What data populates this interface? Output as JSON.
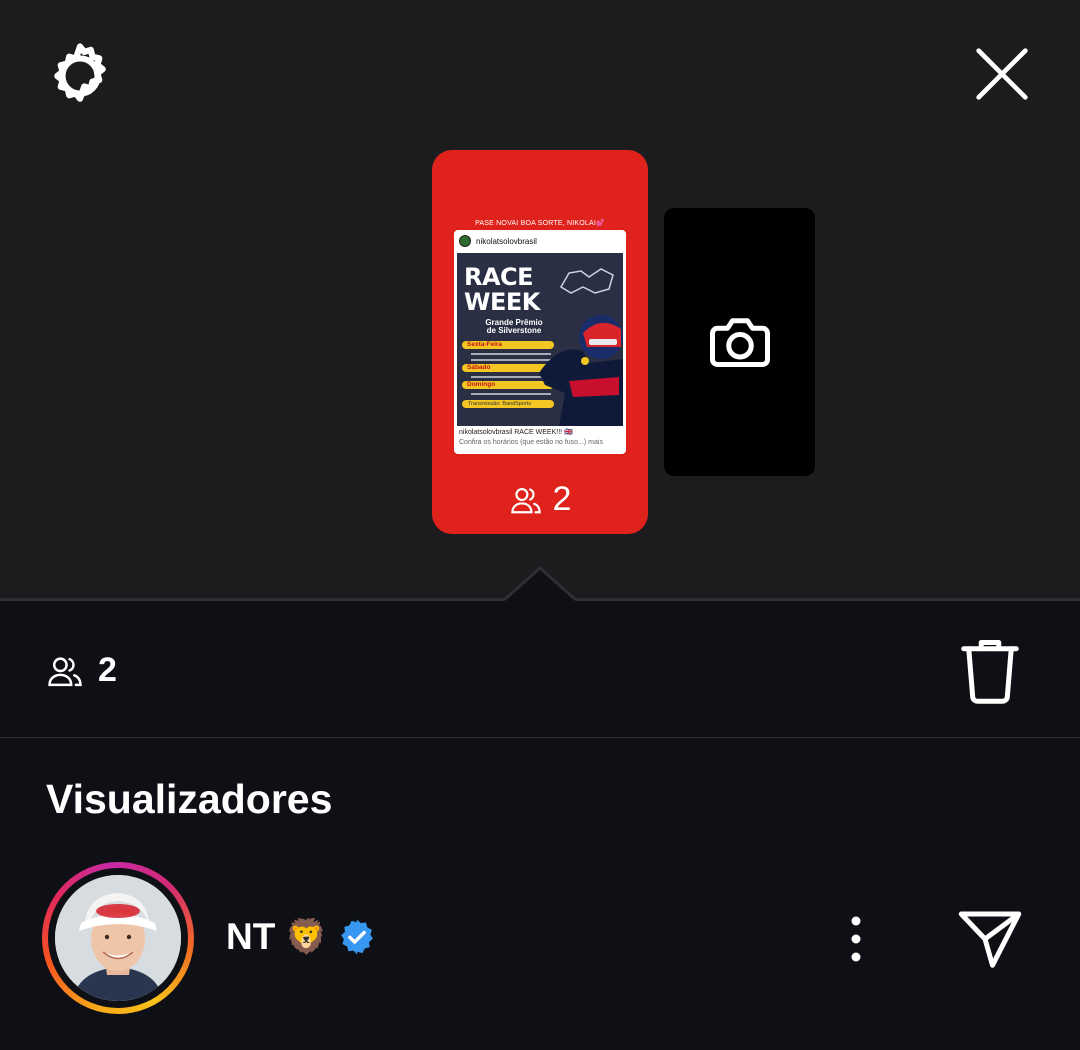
{
  "header": {
    "settings_icon": "gear-icon",
    "close_icon": "close-icon"
  },
  "story": {
    "background_color": "#e0221c",
    "header_text": "PASE NOVAI BOA SORTE, NIKOLAI💕",
    "post": {
      "username": "nikolatsolovbrasil",
      "title_line1": "RACE",
      "title_line2": "WEEK",
      "gp_line1": "Grande Prêmio",
      "gp_line2": "de Silverstone",
      "days": [
        "Sexta-Feira",
        "Sábado",
        "Domingo"
      ],
      "broadcast": "Transmissão: BandSports",
      "caption_line1": "nikolatsolovbrasil RACE WEEK!!! 🇬🇧",
      "caption_line2": "Confira os horários (que estão no fuso...) mais"
    },
    "viewer_count": "2"
  },
  "camera_card": {
    "icon": "camera-icon"
  },
  "summary": {
    "viewer_count": "2",
    "delete_icon": "trash-icon"
  },
  "viewers_section": {
    "title": "Visualizadores",
    "viewers": [
      {
        "name": "NT",
        "emoji": "🦁",
        "verified": true
      }
    ]
  }
}
